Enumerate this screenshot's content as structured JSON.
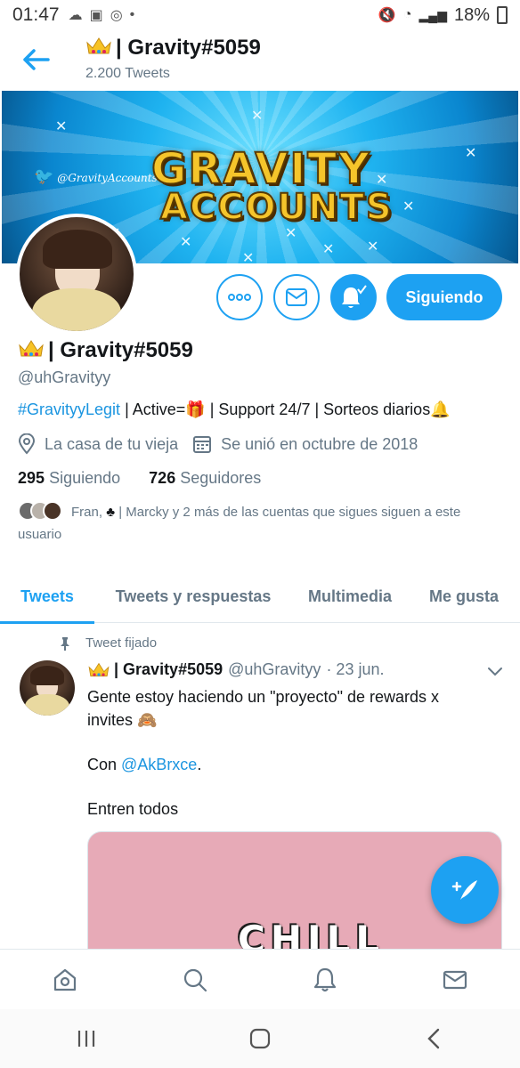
{
  "status_bar": {
    "time": "01:47",
    "battery": "18%"
  },
  "header": {
    "title": "| Gravity#5059",
    "tweet_count": "2.200 Tweets"
  },
  "banner": {
    "line1": "GRAVITY",
    "line2": "ACCOUNTS",
    "twitter_handle": "@GravityAccounts"
  },
  "actions": {
    "following_label": "Siguiendo"
  },
  "profile": {
    "name": "| Gravity#5059",
    "handle": "@uhGravityy",
    "bio_hashtag": "#GravityyLegit",
    "bio_rest_1": " | Active=",
    "bio_rest_2": " | Support 24/7 | Sorteos diarios",
    "location": "La casa de tu vieja",
    "joined": "Se unió en octubre de 2018",
    "following_count": "295",
    "following_label": "Siguiendo",
    "followers_count": "726",
    "followers_label": "Seguidores",
    "mutuals_text_1": "Fran, ",
    "mutuals_text_2": " | Marcky y 2 más de las cuentas que sigues siguen a este usuario"
  },
  "tabs": [
    {
      "label": "Tweets"
    },
    {
      "label": "Tweets y respuestas"
    },
    {
      "label": "Multimedia"
    },
    {
      "label": "Me gusta"
    }
  ],
  "pinned_tweet": {
    "pinned_label": "Tweet fijado",
    "author_name": "| Gravity#5059",
    "author_handle": "@uhGravityy",
    "date": "· 23 jun.",
    "line1": "Gente estoy haciendo un \"proyecto\" de rewards x invites",
    "line2_prefix": " Con ",
    "mention": "@AkBrxce",
    "line2_suffix": ".",
    "line3": "Entren todos",
    "media_text": "CHILL"
  },
  "colors": {
    "accent": "#1da1f2",
    "secondary_text": "#657786"
  },
  "icons": [
    "back-arrow-icon",
    "more-icon",
    "mail-icon",
    "bell-icon",
    "location-icon",
    "calendar-icon",
    "pin-icon",
    "chevron-down-icon",
    "compose-icon",
    "home-icon",
    "search-icon",
    "notifications-icon",
    "messages-icon"
  ]
}
